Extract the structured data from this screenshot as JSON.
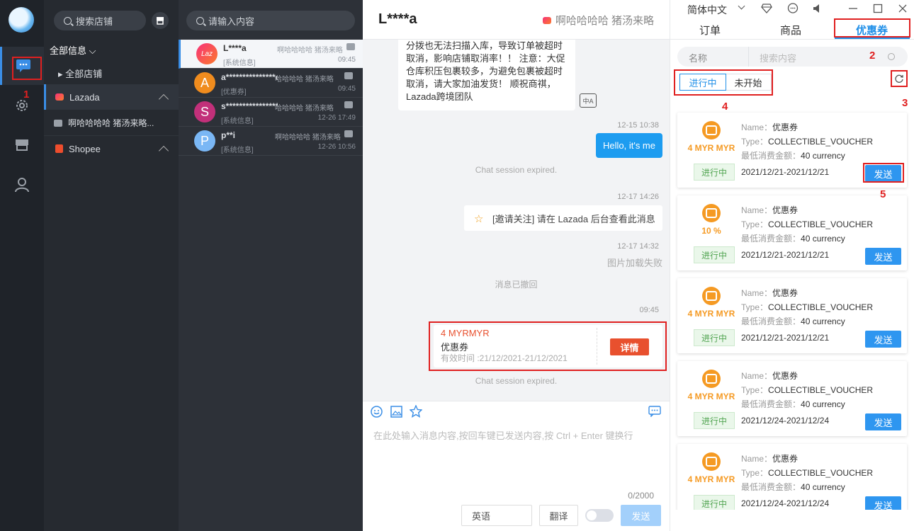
{
  "annotations": [
    "1",
    "2",
    "3",
    "4",
    "5"
  ],
  "stores": {
    "search_label": "搜索店铺",
    "all_info": "全部信息",
    "all_stores": "全部店铺",
    "lazada": "Lazada",
    "lazada_store": "啊哈哈哈哈 猪汤来略...",
    "shopee": "Shopee"
  },
  "conversations": {
    "search_placeholder": "请输入内容",
    "items": [
      {
        "avatar": "Laz",
        "name": "L****a",
        "shop": "啊哈哈哈哈 猪汤来略",
        "tag": "[系统信息]",
        "time": "09:45",
        "color": "#e6447a"
      },
      {
        "avatar": "A",
        "name": "a***************o",
        "shop": "哈哈哈哈 猪汤来略",
        "tag": "[优惠券]",
        "time": "09:45",
        "color": "#f08c1e"
      },
      {
        "avatar": "S",
        "name": "s*****************i",
        "shop": "哈哈哈哈 猪汤来略",
        "tag": "[系统信息]",
        "time": "12-26 17:49",
        "color": "#c2307a"
      },
      {
        "avatar": "P",
        "name": "p**i",
        "shop": "啊哈哈哈哈 猪汤来略",
        "tag": "[系统信息]",
        "time": "12-26 10:56",
        "color": "#7ab7f5"
      }
    ]
  },
  "chat": {
    "title": "L****a",
    "shop": "啊哈哈哈哈 猪汤来略",
    "incoming_text": "分拨也无法扫描入库，导致订单被超时取消，影响店铺取消率！！ 注意：大促仓库积压包裹较多，为避免包裹被超时取消，请大家加油发货！ 顺祝商祺， Lazada跨境团队",
    "ts1": "12-15 10:38",
    "outgoing": "Hello, it's me",
    "expired1": "Chat session expired.",
    "ts2": "12-17 14:26",
    "invite": "[邀请关注] 请在 Lazada 后台查看此消息",
    "ts3": "12-17 14:32",
    "image_fail": "图片加载失败",
    "recalled": "消息已撤回",
    "ts4": "09:45",
    "coupon_amount": "4 MYRMYR",
    "coupon_title": "优惠券",
    "coupon_validity": "有效时间 :21/12/2021-21/12/2021",
    "coupon_detail": "详情",
    "expired2": "Chat session expired.",
    "input_placeholder": "在此处输入消息内容,按回车键已发送内容,按 Ctrl + Enter 键换行",
    "counter": "0/2000",
    "lang": "英语",
    "translate": "翻译",
    "send": "发送"
  },
  "right": {
    "language": "简体中文",
    "tabs": [
      "订单",
      "商品",
      "优惠券"
    ],
    "filter_label": "名称",
    "filter_placeholder": "搜索内容",
    "seg_active": "进行中",
    "seg_inactive": "未开始",
    "coupons": [
      {
        "amount": "4 MYR MYR",
        "name": "优惠券",
        "type": "COLLECTIBLE_VOUCHER",
        "min": "40 currency",
        "status": "进行中",
        "date": "2021/12/21-2021/12/21",
        "send": "发送"
      },
      {
        "amount": "10 %",
        "name": "优惠券",
        "type": "COLLECTIBLE_VOUCHER",
        "min": "40 currency",
        "status": "进行中",
        "date": "2021/12/21-2021/12/21",
        "send": "发送"
      },
      {
        "amount": "4 MYR MYR",
        "name": "优惠券",
        "type": "COLLECTIBLE_VOUCHER",
        "min": "40 currency",
        "status": "进行中",
        "date": "2021/12/21-2021/12/21",
        "send": "发送"
      },
      {
        "amount": "4 MYR MYR",
        "name": "优惠券",
        "type": "COLLECTIBLE_VOUCHER",
        "min": "40 currency",
        "status": "进行中",
        "date": "2021/12/24-2021/12/24",
        "send": "发送"
      },
      {
        "amount": "4 MYR MYR",
        "name": "优惠券",
        "type": "COLLECTIBLE_VOUCHER",
        "min": "40 currency",
        "status": "进行中",
        "date": "2021/12/24-2021/12/24",
        "send": "发送"
      }
    ],
    "name_label": "Name：",
    "type_label": "Type：",
    "min_label": "最低消费金额：",
    "accent": "#1f8fe8"
  }
}
